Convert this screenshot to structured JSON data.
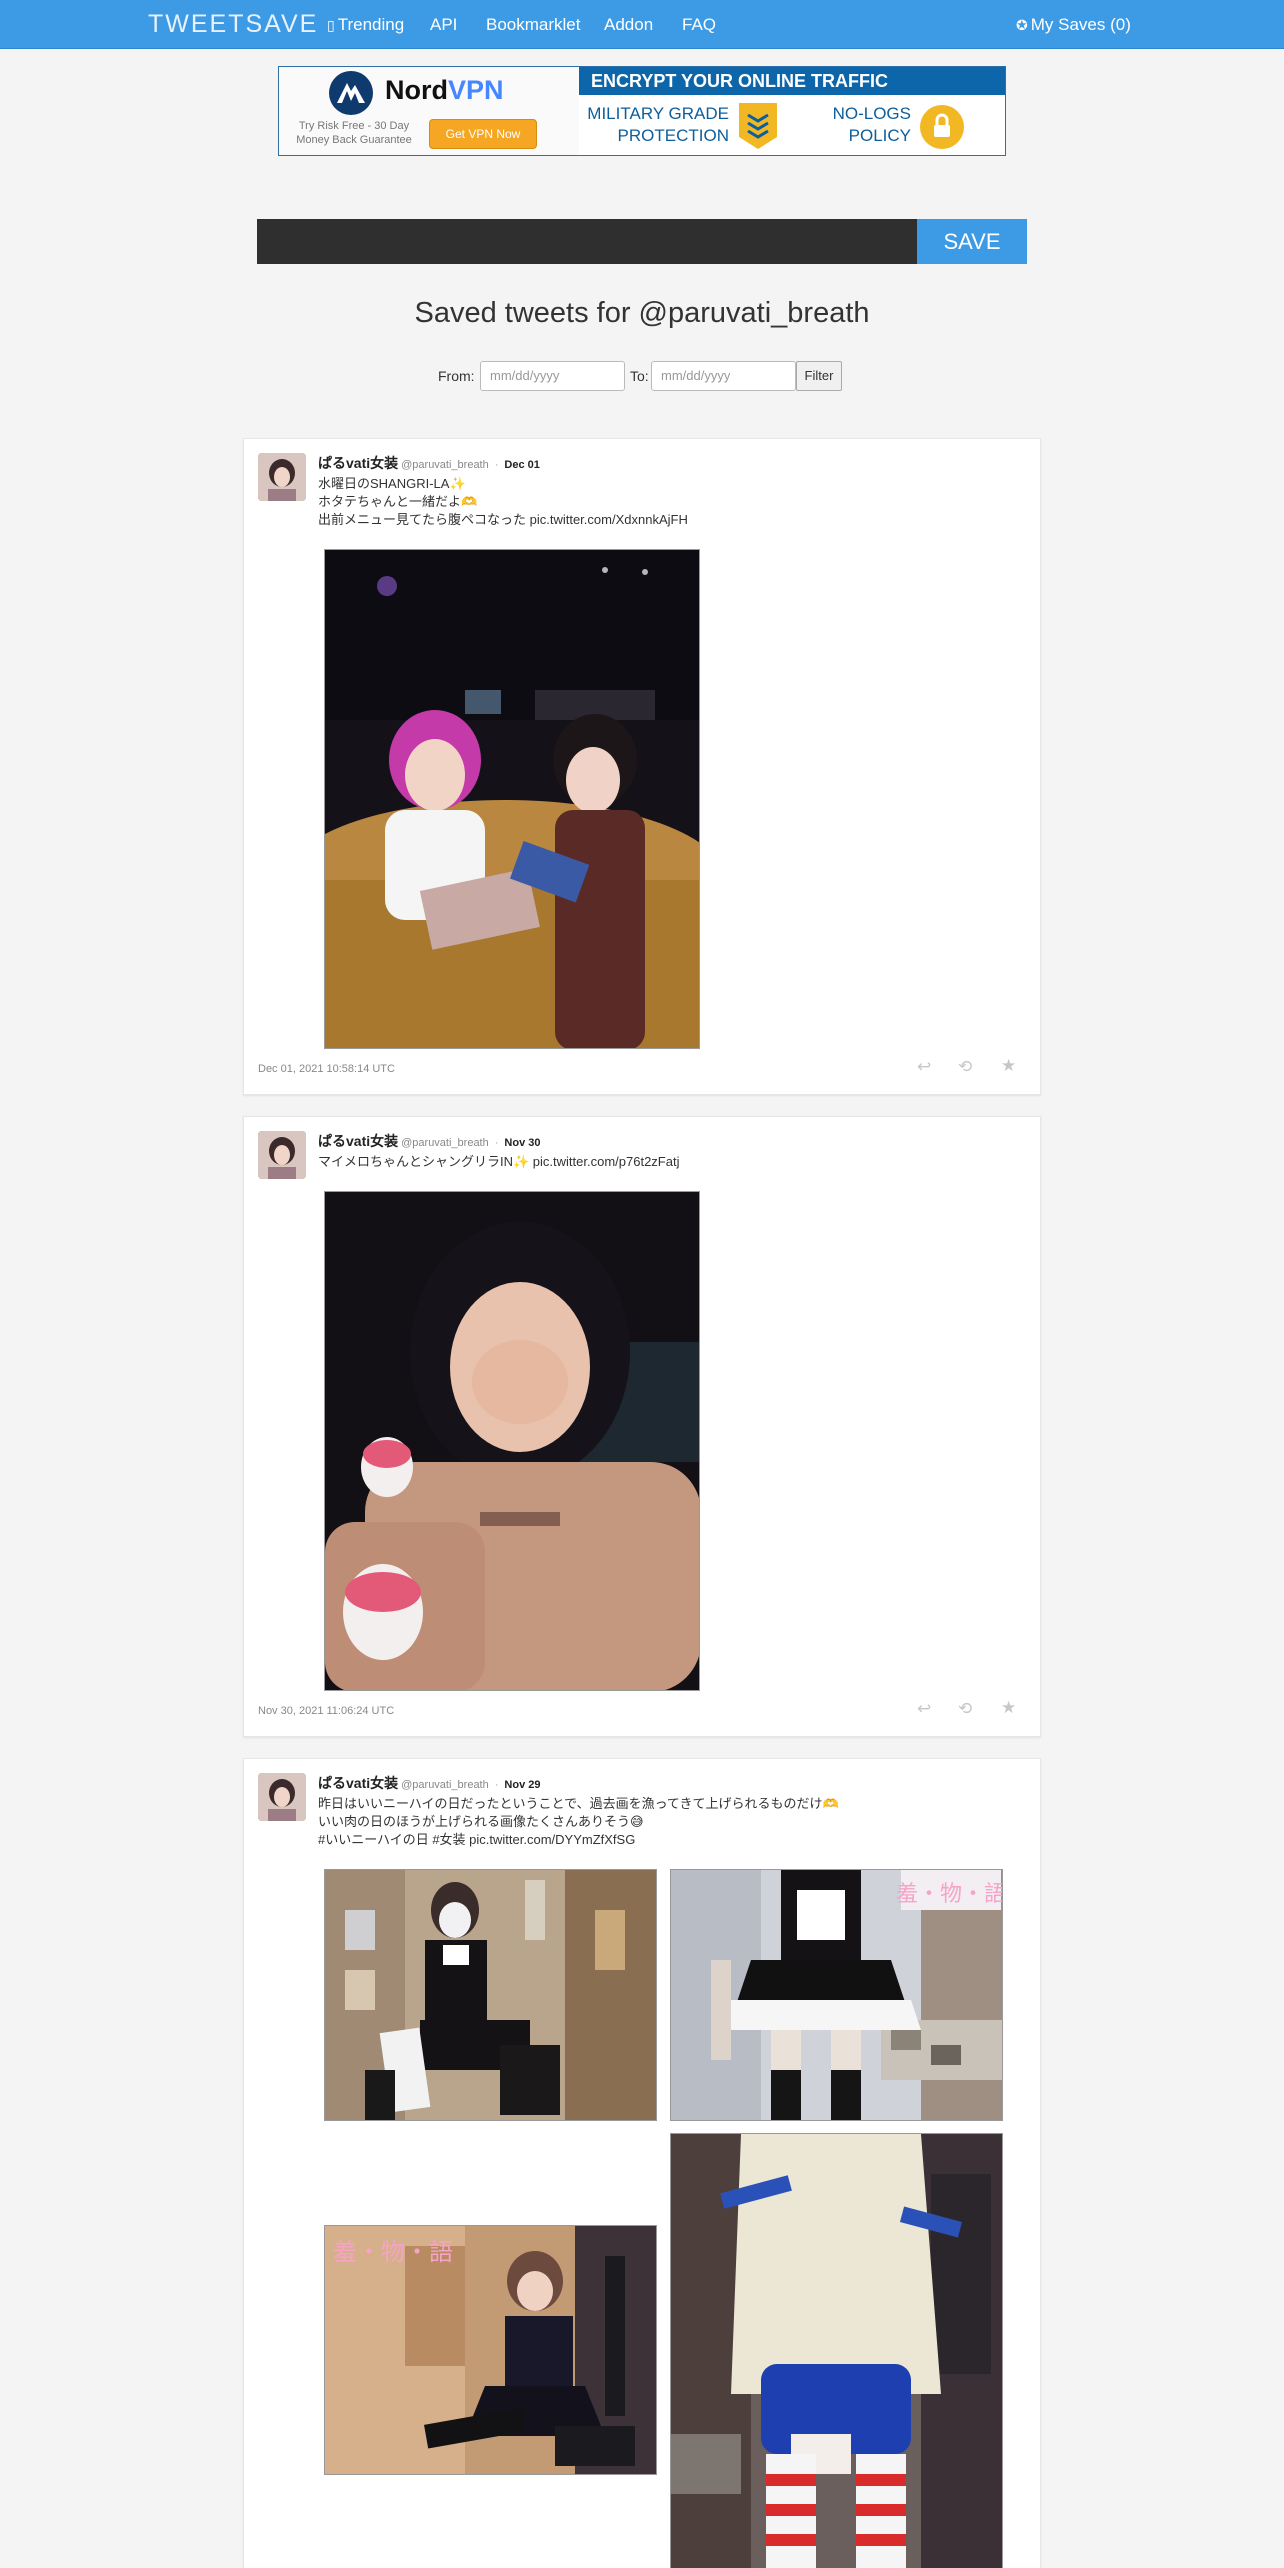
{
  "nav": {
    "brand": "TWEETSAVE",
    "trending": "Trending",
    "trending_icon": "fire-icon",
    "api": "API",
    "bookmarklet": "Bookmarklet",
    "addon": "Addon",
    "faq": "FAQ",
    "my_saves": "My Saves (0)",
    "my_saves_icon": "plus-circle-icon",
    "bg_color": "#3d9ae5"
  },
  "ad": {
    "brand_a": "Nord",
    "brand_b": "VPN",
    "tagline": "Try Risk Free - 30 Day Money Back Guarantee",
    "cta": "Get VPN Now",
    "banner": "ENCRYPT YOUR ONLINE TRAFFIC",
    "feature_1": "MILITARY GRADE\nPROTECTION",
    "feature_2": "NO-LOGS\nPOLICY"
  },
  "save": {
    "input_value": "",
    "button": "SAVE"
  },
  "page": {
    "title": "Saved tweets for @paruvati_breath"
  },
  "filter": {
    "from_label": "From:",
    "to_label": "To:",
    "from_placeholder": "mm/dd/yyyy",
    "to_placeholder": "mm/dd/yyyy",
    "button": "Filter"
  },
  "tweets": [
    {
      "name": "ぱるvati女装",
      "handle": "@paruvati_breath",
      "date": "Dec 01",
      "text": "水曜日のSHANGRI-LA✨\nホタテちゃんと一緒だよ🫶\n出前メニュー見てたら腹ペコなった pic.twitter.com/XdxnnkAjFH",
      "timestamp": "Dec 01, 2021 10:58:14 UTC"
    },
    {
      "name": "ぱるvati女装",
      "handle": "@paruvati_breath",
      "date": "Nov 30",
      "text": "マイメロちゃんとシャングリラIN✨ pic.twitter.com/p76t2zFatj",
      "timestamp": "Nov 30, 2021 11:06:24 UTC"
    },
    {
      "name": "ぱるvati女装",
      "handle": "@paruvati_breath",
      "date": "Nov 29",
      "text": "昨日はいいニーハイの日だったということで、過去画を漁ってきて上げられるものだけ🫶\nいい肉の日のほうが上げられる画像たくさんありそう😅\n#いいニーハイの日 #女装 pic.twitter.com/DYYmZfXfSG",
      "timestamp": ""
    }
  ],
  "actions": {
    "reply_icon": "reply-icon",
    "retweet_icon": "retweet-icon",
    "favorite_icon": "star-icon"
  },
  "image_overlays": {
    "watermark_1": "羞・物・語",
    "watermark_2": "羞・物・語"
  }
}
